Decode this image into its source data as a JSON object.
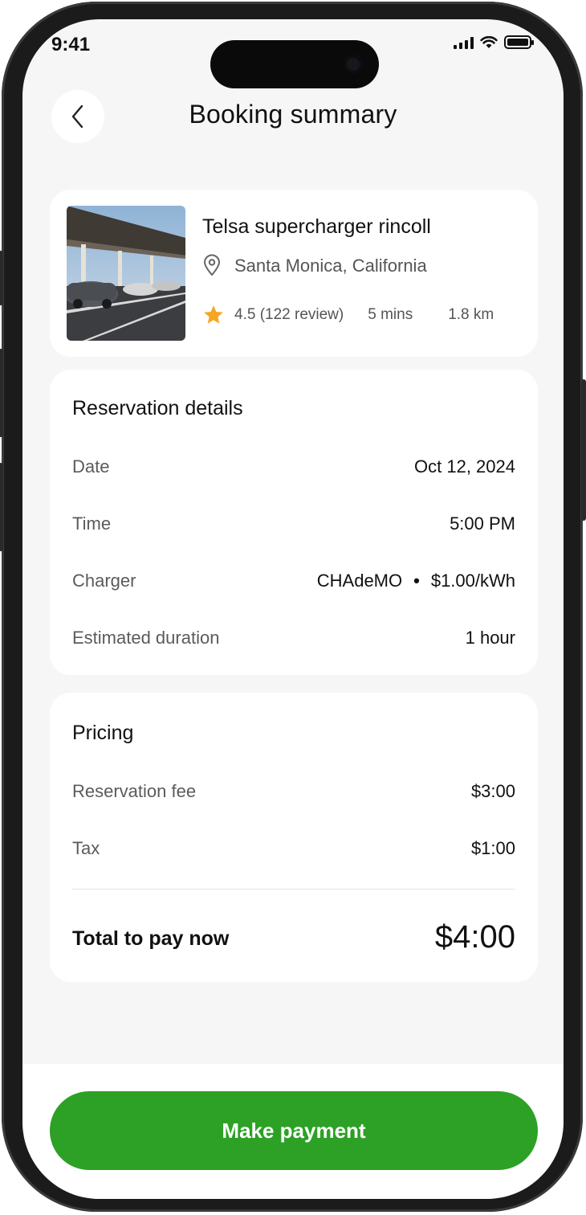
{
  "status_bar": {
    "time": "9:41"
  },
  "header": {
    "title": "Booking summary",
    "back_icon": "chevron-left-icon"
  },
  "station": {
    "name": "Telsa supercharger rincoll",
    "location": "Santa Monica, California",
    "rating": "4.5 (122 review)",
    "travel_time": "5 mins",
    "distance": "1.8 km"
  },
  "reservation": {
    "heading": "Reservation details",
    "rows": [
      {
        "label": "Date",
        "value": "Oct 12, 2024"
      },
      {
        "label": "Time",
        "value": "5:00 PM"
      },
      {
        "label": "Charger",
        "value_type": "CHAdeMO",
        "value_rate": "$1.00/kWh"
      },
      {
        "label": "Estimated duration",
        "value": "1 hour"
      }
    ]
  },
  "pricing": {
    "heading": "Pricing",
    "rows": [
      {
        "label": "Reservation fee",
        "value": "$3:00"
      },
      {
        "label": "Tax",
        "value": "$1:00"
      }
    ],
    "total_label": "Total to pay now",
    "total_value": "$4:00"
  },
  "actions": {
    "pay_label": "Make payment"
  },
  "colors": {
    "accent": "#2ca125",
    "star": "#f5a623",
    "background": "#f6f6f6"
  }
}
